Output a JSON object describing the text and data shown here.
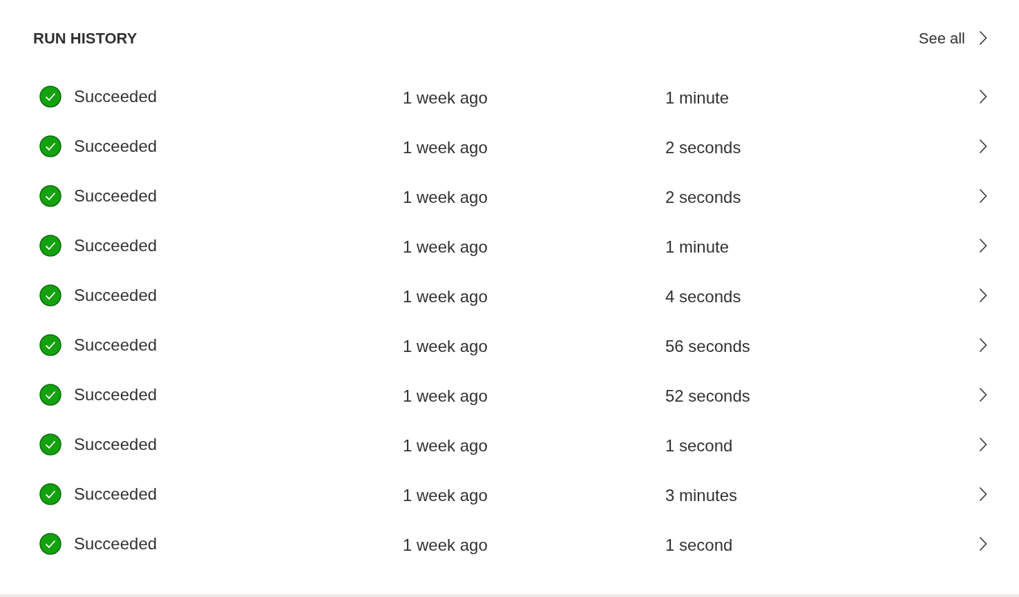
{
  "header": {
    "title": "RUN HISTORY",
    "see_all": "See all"
  },
  "runs": [
    {
      "kind": "succeeded",
      "status": "Succeeded",
      "started": "1 week ago",
      "duration": "1 minute"
    },
    {
      "kind": "succeeded",
      "status": "Succeeded",
      "started": "1 week ago",
      "duration": "2 seconds"
    },
    {
      "kind": "succeeded",
      "status": "Succeeded",
      "started": "1 week ago",
      "duration": "2 seconds"
    },
    {
      "kind": "succeeded",
      "status": "Succeeded",
      "started": "1 week ago",
      "duration": "1 minute"
    },
    {
      "kind": "succeeded",
      "status": "Succeeded",
      "started": "1 week ago",
      "duration": "4 seconds"
    },
    {
      "kind": "succeeded",
      "status": "Succeeded",
      "started": "1 week ago",
      "duration": "56 seconds"
    },
    {
      "kind": "succeeded",
      "status": "Succeeded",
      "started": "1 week ago",
      "duration": "52 seconds"
    },
    {
      "kind": "succeeded",
      "status": "Succeeded",
      "started": "1 week ago",
      "duration": "1 second"
    },
    {
      "kind": "succeeded",
      "status": "Succeeded",
      "started": "1 week ago",
      "duration": "3 minutes"
    },
    {
      "kind": "succeeded",
      "status": "Succeeded",
      "started": "1 week ago",
      "duration": "1 second"
    }
  ]
}
